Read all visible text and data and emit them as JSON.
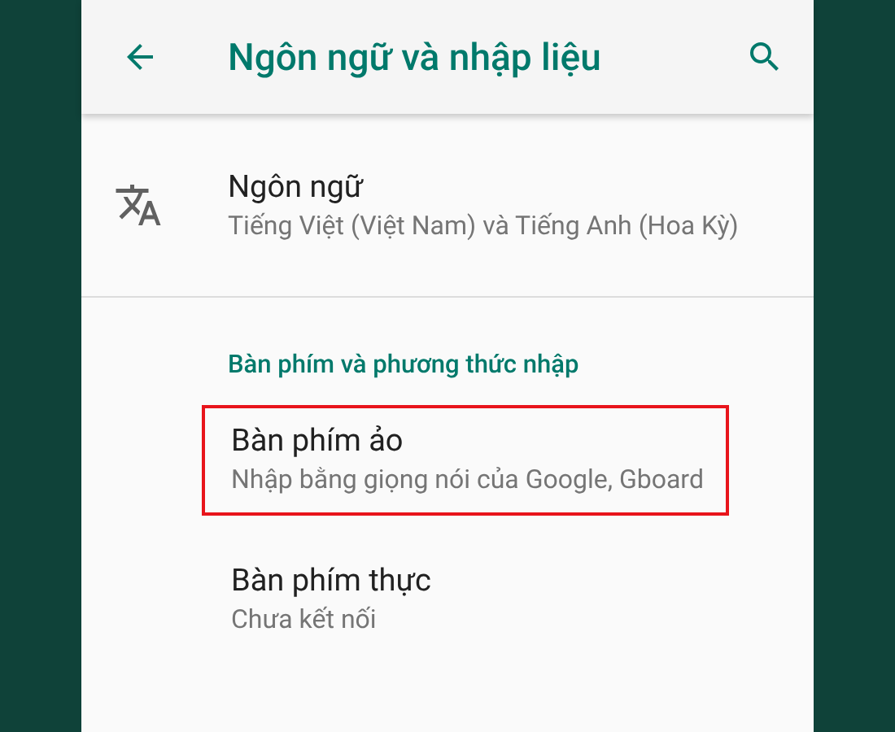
{
  "app_bar": {
    "title": "Ngôn ngữ và nhập liệu"
  },
  "items": [
    {
      "kind": "icon_item",
      "title": "Ngôn ngữ",
      "summary": "Tiếng Việt (Việt Nam) và Tiếng Anh (Hoa Kỳ)"
    },
    {
      "kind": "header",
      "title": "Bàn phím và phương thức nhập"
    },
    {
      "kind": "item",
      "title": "Bàn phím ảo",
      "summary": "Nhập bằng giọng nói của Google, Gboard",
      "highlighted": true
    },
    {
      "kind": "item",
      "title": "Bàn phím thực",
      "summary": "Chưa kết nối",
      "highlighted": false
    }
  ]
}
